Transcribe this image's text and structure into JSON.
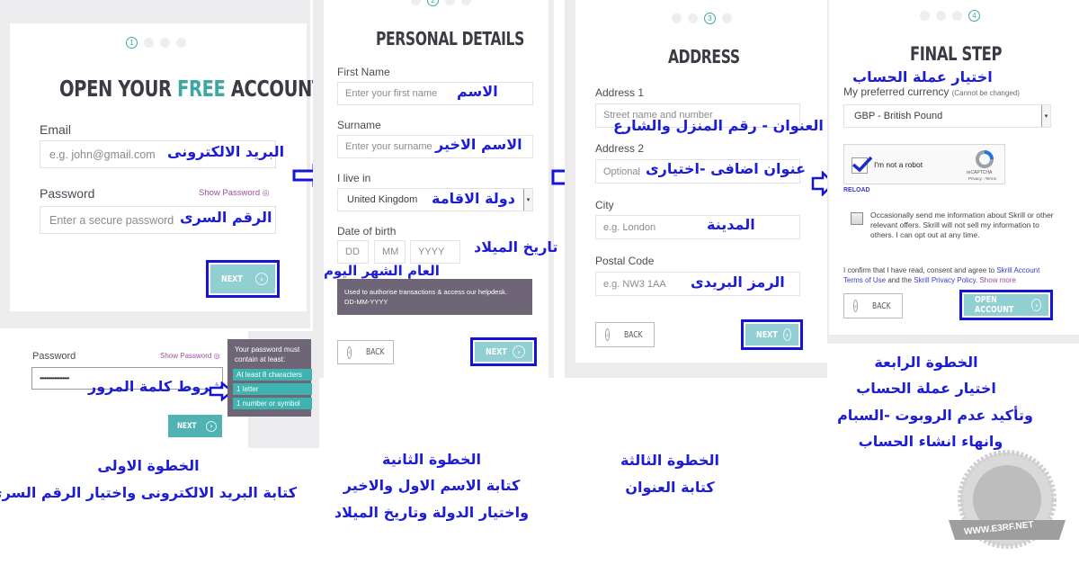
{
  "step1": {
    "dots": [
      "1",
      "",
      "",
      ""
    ],
    "title_before": "OPEN YOUR ",
    "title_accent": "FREE",
    "title_after": " ACCOUNT",
    "email_label": "Email",
    "email_placeholder": "e.g. john@gmail.com",
    "email_annotation": "البريد الالكترونى",
    "password_label": "Password",
    "show_password": "Show Password",
    "password_placeholder": "Enter a secure password",
    "password_annotation": "الرقم السرى",
    "next_label": "NEXT"
  },
  "step1_detail": {
    "password_label": "Password",
    "show_password": "Show Password",
    "password_value": "••••••••••••••••••",
    "annotation": "شروط كلمة المرور",
    "tooltip_title": "Your password must contain at least:",
    "rules": [
      "At least 8 characters",
      "1 letter",
      "1 number or symbol"
    ],
    "next_label": "NEXT"
  },
  "step2": {
    "dots": [
      "",
      "2",
      "",
      ""
    ],
    "title": "PERSONAL DETAILS",
    "first_name_label": "First Name",
    "first_name_placeholder": "Enter your first name",
    "first_name_annotation": "الاسم",
    "surname_label": "Surname",
    "surname_placeholder": "Enter your surname",
    "surname_annotation": "الاسم الاخير",
    "live_label": "I live in",
    "country_value": "United Kingdom",
    "country_annotation": "دولة الاقامة",
    "dob_label": "Date of birth",
    "dd_placeholder": "DD",
    "mm_placeholder": "MM",
    "yyyy_placeholder": "YYYY",
    "dob_annotation": "تاريخ الميلاد",
    "dob_parts_annotation": "العام   الشهر   اليوم",
    "dob_hint_line1": "Used to authorise transactions & access our helpdesk.",
    "dob_hint_line2": "DD-MM-YYYY",
    "back_label": "BACK",
    "next_label": "NEXT"
  },
  "step3": {
    "dots": [
      "",
      "",
      "3",
      ""
    ],
    "title": "ADDRESS",
    "address1_label": "Address 1",
    "address1_placeholder": "Street name and number",
    "address1_annotation": "العنوان - رقم المنزل والشارع",
    "address2_label": "Address 2",
    "address2_placeholder": "Optional",
    "address2_annotation": "عنوان اضافى -اختيارى",
    "city_label": "City",
    "city_placeholder": "e.g. London",
    "city_annotation": "المدينة",
    "postal_label": "Postal Code",
    "postal_placeholder": "e.g. NW3 1AA",
    "postal_annotation": "الرمز البريدى",
    "back_label": "BACK",
    "next_label": "NEXT"
  },
  "step4": {
    "dots": [
      "",
      "",
      "",
      "4"
    ],
    "title": "FINAL STEP",
    "currency_annotation": "اختيار عملة الحساب",
    "currency_label": "My preferred currency",
    "currency_note": "(Cannot be changed)",
    "currency_value": "GBP - British Pound",
    "captcha_label": "I'm not a robot",
    "captcha_brand": "reCAPTCHA",
    "captcha_links": "Privacy - Terms",
    "captcha_checked": true,
    "reload_label": "RELOAD",
    "offers_text": "Occasionally send me information about Skrill or other relevant offers. Skrill will not sell my information to others. I can opt out at any time.",
    "offers_checked": false,
    "confirm_prefix": "I confirm that I have read, consent and agree to ",
    "terms_link": "Skrill Account Terms of Use",
    "confirm_middle": " and the ",
    "privacy_link": "Skrill Privacy Policy",
    "confirm_dot": ". ",
    "show_more": "Show more",
    "back_label": "BACK",
    "open_account_label": "OPEN ACCOUNT"
  },
  "captions": {
    "step1_title": "الخطوة الاولى",
    "step1_desc": "كتابة البريد الالكترونى واختيار الرقم السرى",
    "step2_title": "الخطوة الثانية",
    "step2_desc1": "كتابة الاسم الاول والاخير",
    "step2_desc2": "واختيار الدولة وتاريخ الميلاد",
    "step3_title": "الخطوة الثالثة",
    "step3_desc": "كتابة العنوان",
    "step4_title": "الخطوة الرابعة",
    "step4_desc1": "اختيار عملة الحساب",
    "step4_desc2": "وتأكيد عدم الروبوت -السبام",
    "step4_desc3": "وانهاء انشاء الحساب"
  },
  "watermark": {
    "site": "WWW.E3RF.NET"
  },
  "colors": {
    "accent_teal": "#3fa7a2",
    "button_teal": "#91cfd2",
    "annotation_blue": "#1d1dd8",
    "tooltip_purple": "#6e6677"
  }
}
